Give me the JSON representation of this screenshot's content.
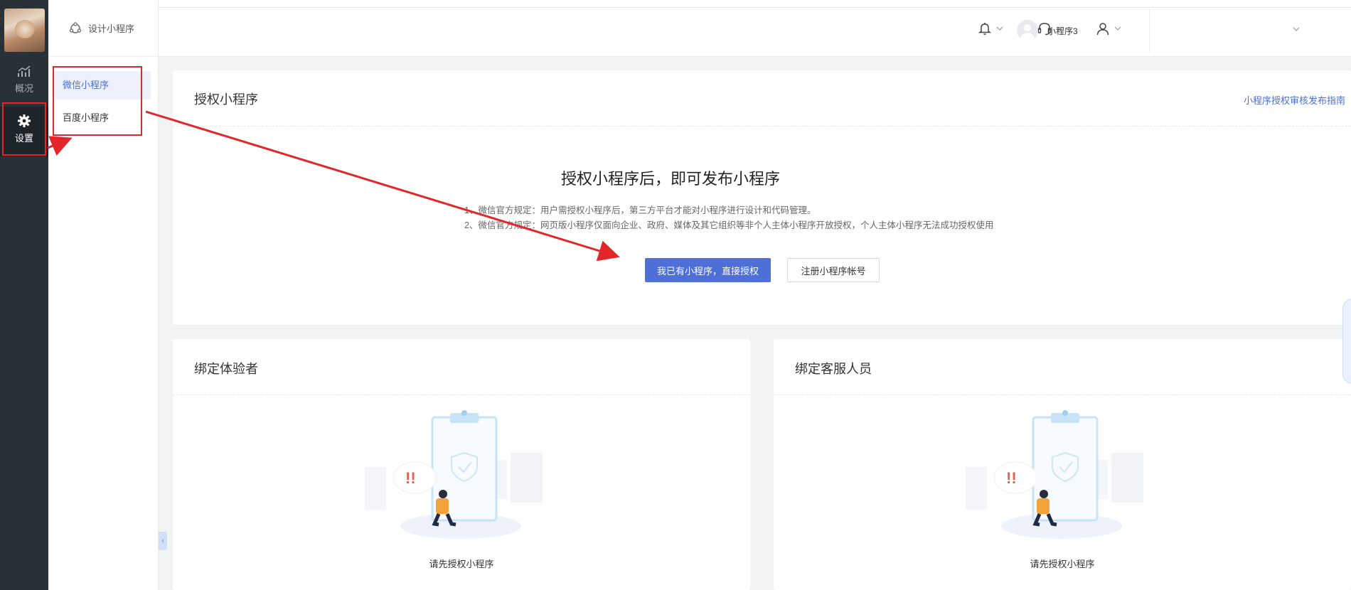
{
  "rail": {
    "items": [
      {
        "label": "概况",
        "icon": "chart-icon"
      },
      {
        "label": "设置",
        "icon": "gear-icon"
      }
    ]
  },
  "submenu": {
    "header": "设计小程序",
    "items": [
      {
        "label": "微信小程序",
        "active": true
      },
      {
        "label": "百度小程序",
        "active": false
      }
    ]
  },
  "topbar": {
    "icons": [
      "bell-icon",
      "headset-icon",
      "user-icon"
    ],
    "username": "小程序3"
  },
  "auth_card": {
    "title": "授权小程序",
    "guide_link": "小程序授权审核发布指南",
    "heading": "授权小程序后，即可发布小程序",
    "notes": [
      "1、微信官方规定：用户需授权小程序后，第三方平台才能对小程序进行设计和代码管理。",
      "2、微信官方规定：网页版小程序仅面向企业、政府、媒体及其它组织等非个人主体小程序开放授权，个人主体小程序无法成功授权使用"
    ],
    "primary_button": "我已有小程序，直接授权",
    "secondary_button": "注册小程序帐号"
  },
  "bind_testers": {
    "title": "绑定体验者",
    "empty_text": "请先授权小程序"
  },
  "bind_service": {
    "title": "绑定客服人员",
    "empty_text": "请先授权小程序"
  },
  "colors": {
    "accent": "#4e6fd7",
    "rail": "#283137",
    "annotation": "#e3262a"
  }
}
